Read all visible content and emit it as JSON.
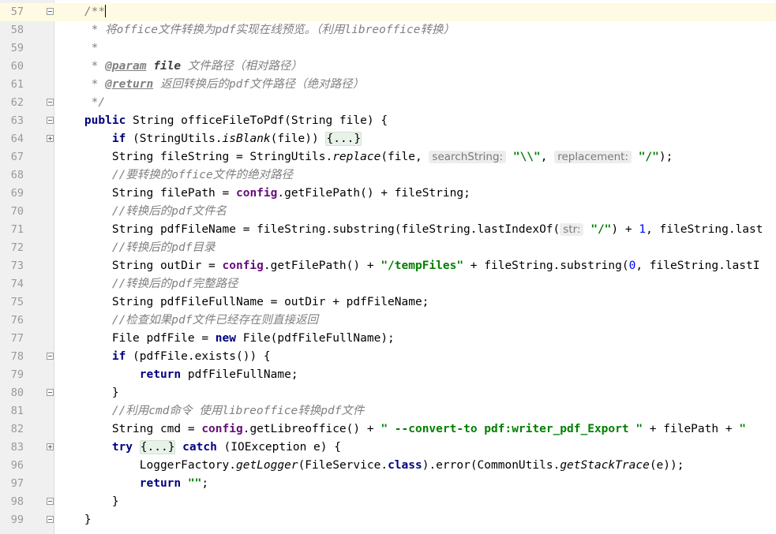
{
  "editor": {
    "colors": {
      "keyword": "#000080",
      "string": "#008000",
      "comment": "#808080",
      "number": "#0000ff",
      "field": "#660e7a",
      "gutter": "#f0f0f0",
      "current_line": "#fffae3"
    },
    "lines": [
      {
        "n": "57",
        "current": true,
        "fold": "minus",
        "tokens": [
          {
            "t": "    "
          },
          {
            "t": "/**",
            "c": "doc"
          },
          {
            "t": "",
            "c": "cursor"
          }
        ]
      },
      {
        "n": "58",
        "tokens": [
          {
            "t": "     * 将office文件转换为pdf实现在线预览。（利用libreoffice转换）",
            "c": "doc"
          }
        ]
      },
      {
        "n": "59",
        "tokens": [
          {
            "t": "     *",
            "c": "doc"
          }
        ]
      },
      {
        "n": "60",
        "tokens": [
          {
            "t": "     * ",
            "c": "doc"
          },
          {
            "t": "@param",
            "c": "tag"
          },
          {
            "t": " ",
            "c": "doc"
          },
          {
            "t": "file",
            "c": "pname"
          },
          {
            "t": " 文件路径（相对路径）",
            "c": "doc"
          }
        ]
      },
      {
        "n": "61",
        "tokens": [
          {
            "t": "     * ",
            "c": "doc"
          },
          {
            "t": "@return",
            "c": "tag"
          },
          {
            "t": " 返回转换后的pdf文件路径（绝对路径）",
            "c": "doc"
          }
        ]
      },
      {
        "n": "62",
        "fold": "minus",
        "tokens": [
          {
            "t": "     */",
            "c": "doc"
          }
        ]
      },
      {
        "n": "63",
        "fold": "minus",
        "tokens": [
          {
            "t": "    "
          },
          {
            "t": "public",
            "c": "kw"
          },
          {
            "t": " String officeFileToPdf(String file) {"
          }
        ]
      },
      {
        "n": "64",
        "fold": "plus",
        "tokens": [
          {
            "t": "        "
          },
          {
            "t": "if",
            "c": "kw"
          },
          {
            "t": " (StringUtils."
          },
          {
            "t": "isBlank",
            "c": "italic"
          },
          {
            "t": "(file)) "
          },
          {
            "t": "{...}",
            "c": "fold"
          }
        ]
      },
      {
        "n": "67",
        "tokens": [
          {
            "t": "        String fileString = StringUtils."
          },
          {
            "t": "replace",
            "c": "italic"
          },
          {
            "t": "(file, "
          },
          {
            "t": "searchString:",
            "c": "hint"
          },
          {
            "t": " "
          },
          {
            "t": "\"\\\\\"",
            "c": "str"
          },
          {
            "t": ", "
          },
          {
            "t": "replacement:",
            "c": "hint"
          },
          {
            "t": " "
          },
          {
            "t": "\"/\"",
            "c": "str"
          },
          {
            "t": ");"
          }
        ]
      },
      {
        "n": "68",
        "tokens": [
          {
            "t": "        //要转换的office文件的绝对路径",
            "c": "cmt"
          }
        ]
      },
      {
        "n": "69",
        "tokens": [
          {
            "t": "        String filePath = "
          },
          {
            "t": "config",
            "c": "field"
          },
          {
            "t": ".getFilePath() + fileString;"
          }
        ]
      },
      {
        "n": "70",
        "tokens": [
          {
            "t": "        //转换后的pdf文件名",
            "c": "cmt"
          }
        ]
      },
      {
        "n": "71",
        "tokens": [
          {
            "t": "        String pdfFileName = fileString.substring(fileString.lastIndexOf("
          },
          {
            "t": "str:",
            "c": "hint"
          },
          {
            "t": " "
          },
          {
            "t": "\"/\"",
            "c": "str"
          },
          {
            "t": ") + "
          },
          {
            "t": "1",
            "c": "num"
          },
          {
            "t": ", fileString.last"
          }
        ]
      },
      {
        "n": "72",
        "tokens": [
          {
            "t": "        //转换后的pdf目录",
            "c": "cmt"
          }
        ]
      },
      {
        "n": "73",
        "tokens": [
          {
            "t": "        String outDir = "
          },
          {
            "t": "config",
            "c": "field"
          },
          {
            "t": ".getFilePath() + "
          },
          {
            "t": "\"/tempFiles\"",
            "c": "str"
          },
          {
            "t": " + fileString.substring("
          },
          {
            "t": "0",
            "c": "num"
          },
          {
            "t": ", fileString.lastI"
          }
        ]
      },
      {
        "n": "74",
        "tokens": [
          {
            "t": "        //转换后的pdf完整路径",
            "c": "cmt"
          }
        ]
      },
      {
        "n": "75",
        "tokens": [
          {
            "t": "        String pdfFileFullName = outDir + pdfFileName;"
          }
        ]
      },
      {
        "n": "76",
        "tokens": [
          {
            "t": "        //检查如果pdf文件已经存在则直接返回",
            "c": "cmt"
          }
        ]
      },
      {
        "n": "77",
        "tokens": [
          {
            "t": "        File pdfFile = "
          },
          {
            "t": "new",
            "c": "kw"
          },
          {
            "t": " File(pdfFileFullName);"
          }
        ]
      },
      {
        "n": "78",
        "fold": "minus",
        "tokens": [
          {
            "t": "        "
          },
          {
            "t": "if",
            "c": "kw"
          },
          {
            "t": " (pdfFile.exists()) {"
          }
        ]
      },
      {
        "n": "79",
        "tokens": [
          {
            "t": "            "
          },
          {
            "t": "return",
            "c": "kw"
          },
          {
            "t": " pdfFileFullName;"
          }
        ]
      },
      {
        "n": "80",
        "fold": "minus",
        "tokens": [
          {
            "t": "        }"
          }
        ]
      },
      {
        "n": "81",
        "tokens": [
          {
            "t": "        //利用cmd命令 使用libreoffice转换pdf文件",
            "c": "cmt"
          }
        ]
      },
      {
        "n": "82",
        "tokens": [
          {
            "t": "        String cmd = "
          },
          {
            "t": "config",
            "c": "field"
          },
          {
            "t": ".getLibreoffice() + "
          },
          {
            "t": "\" --convert-to pdf:writer_pdf_Export \"",
            "c": "str"
          },
          {
            "t": " + filePath + "
          },
          {
            "t": "\"",
            "c": "str"
          }
        ]
      },
      {
        "n": "83",
        "fold": "plus",
        "tokens": [
          {
            "t": "        "
          },
          {
            "t": "try",
            "c": "kw"
          },
          {
            "t": " "
          },
          {
            "t": "{...}",
            "c": "fold"
          },
          {
            "t": " "
          },
          {
            "t": "catch",
            "c": "kw"
          },
          {
            "t": " (IOException e) {"
          }
        ]
      },
      {
        "n": "96",
        "tokens": [
          {
            "t": "            LoggerFactory."
          },
          {
            "t": "getLogger",
            "c": "italic"
          },
          {
            "t": "(FileService."
          },
          {
            "t": "class",
            "c": "kw"
          },
          {
            "t": ").error(CommonUtils."
          },
          {
            "t": "getStackTrace",
            "c": "italic"
          },
          {
            "t": "(e));"
          }
        ]
      },
      {
        "n": "97",
        "tokens": [
          {
            "t": "            "
          },
          {
            "t": "return",
            "c": "kw"
          },
          {
            "t": " "
          },
          {
            "t": "\"\"",
            "c": "str"
          },
          {
            "t": ";"
          }
        ]
      },
      {
        "n": "98",
        "fold": "minus",
        "tokens": [
          {
            "t": "        }"
          }
        ]
      },
      {
        "n": "99",
        "fold": "minus",
        "tokens": [
          {
            "t": "    }"
          }
        ]
      }
    ]
  }
}
